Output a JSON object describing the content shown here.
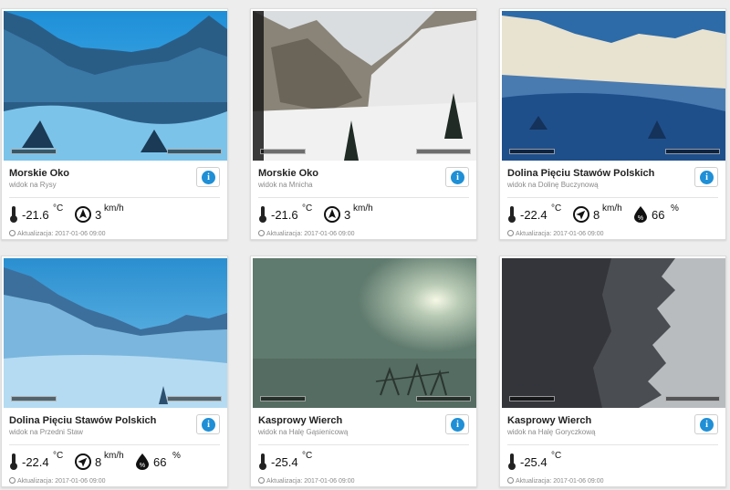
{
  "cards": [
    {
      "title": "Morskie Oko",
      "subtitle": "widok na Rysy",
      "temp": "-21.6",
      "temp_unit": "°C",
      "wind": "3",
      "wind_unit": "km/h",
      "updated": "Aktualizacja: 2017-01-06 09:00"
    },
    {
      "title": "Morskie Oko",
      "subtitle": "widok na Mnicha",
      "temp": "-21.6",
      "temp_unit": "°C",
      "wind": "3",
      "wind_unit": "km/h",
      "updated": "Aktualizacja: 2017-01-06 09:00"
    },
    {
      "title": "Dolina Pięciu Stawów Polskich",
      "subtitle": "widok na Dolinę Buczynową",
      "temp": "-22.4",
      "temp_unit": "°C",
      "wind": "8",
      "wind_unit": "km/h",
      "humidity": "66",
      "humidity_unit": "%",
      "updated": "Aktualizacja: 2017-01-06 09:00"
    },
    {
      "title": "Dolina Pięciu Stawów Polskich",
      "subtitle": "widok na Przedni Staw",
      "temp": "-22.4",
      "temp_unit": "°C",
      "wind": "8",
      "wind_unit": "km/h",
      "humidity": "66",
      "humidity_unit": "%",
      "updated": "Aktualizacja: 2017-01-06 09:00"
    },
    {
      "title": "Kasprowy Wierch",
      "subtitle": "widok na Halę Gąsienicową",
      "temp": "-25.4",
      "temp_unit": "°C",
      "updated": "Aktualizacja: 2017-01-06 09:00"
    },
    {
      "title": "Kasprowy Wierch",
      "subtitle": "widok na Halę Goryczkową",
      "temp": "-25.4",
      "temp_unit": "°C",
      "updated": "Aktualizacja: 2017-01-06 09:00"
    }
  ],
  "icons": {
    "temperature": "thermometer-icon",
    "wind": "wind-compass-icon",
    "humidity": "humidity-drop-icon",
    "info": "info-icon",
    "clock": "clock-icon"
  },
  "colors": {
    "info_button": "#1f8fd6",
    "page_background": "#ededed"
  }
}
